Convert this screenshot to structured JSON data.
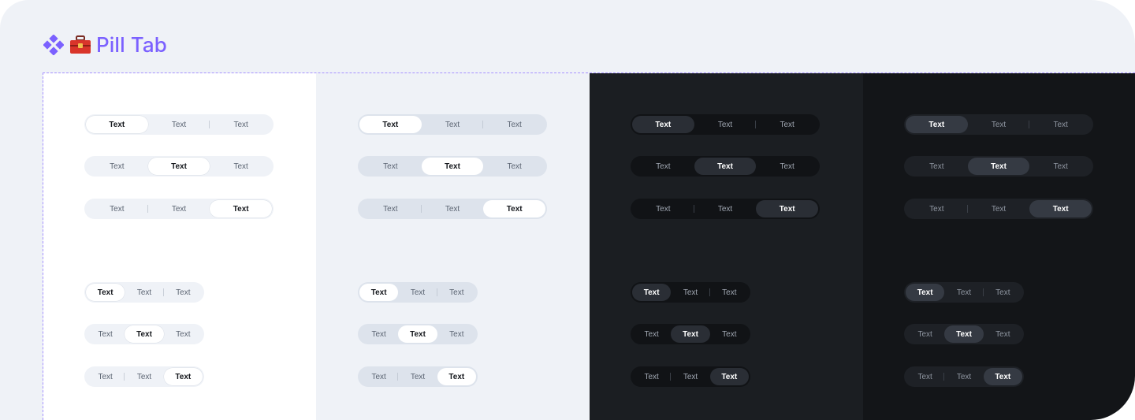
{
  "header": {
    "title": "Pill Tab",
    "icons": [
      "component-diamond-icon",
      "toolbox-icon"
    ]
  },
  "colors": {
    "accent": "#7B61FF",
    "frame_bg": "#EFF2F7",
    "col_light": "#FFFFFF",
    "col_light_gray": "#EFF2F7",
    "col_dark": "#1B1E22",
    "col_darker": "#131518"
  },
  "tabs": {
    "labels": [
      "Text",
      "Text",
      "Text"
    ]
  }
}
